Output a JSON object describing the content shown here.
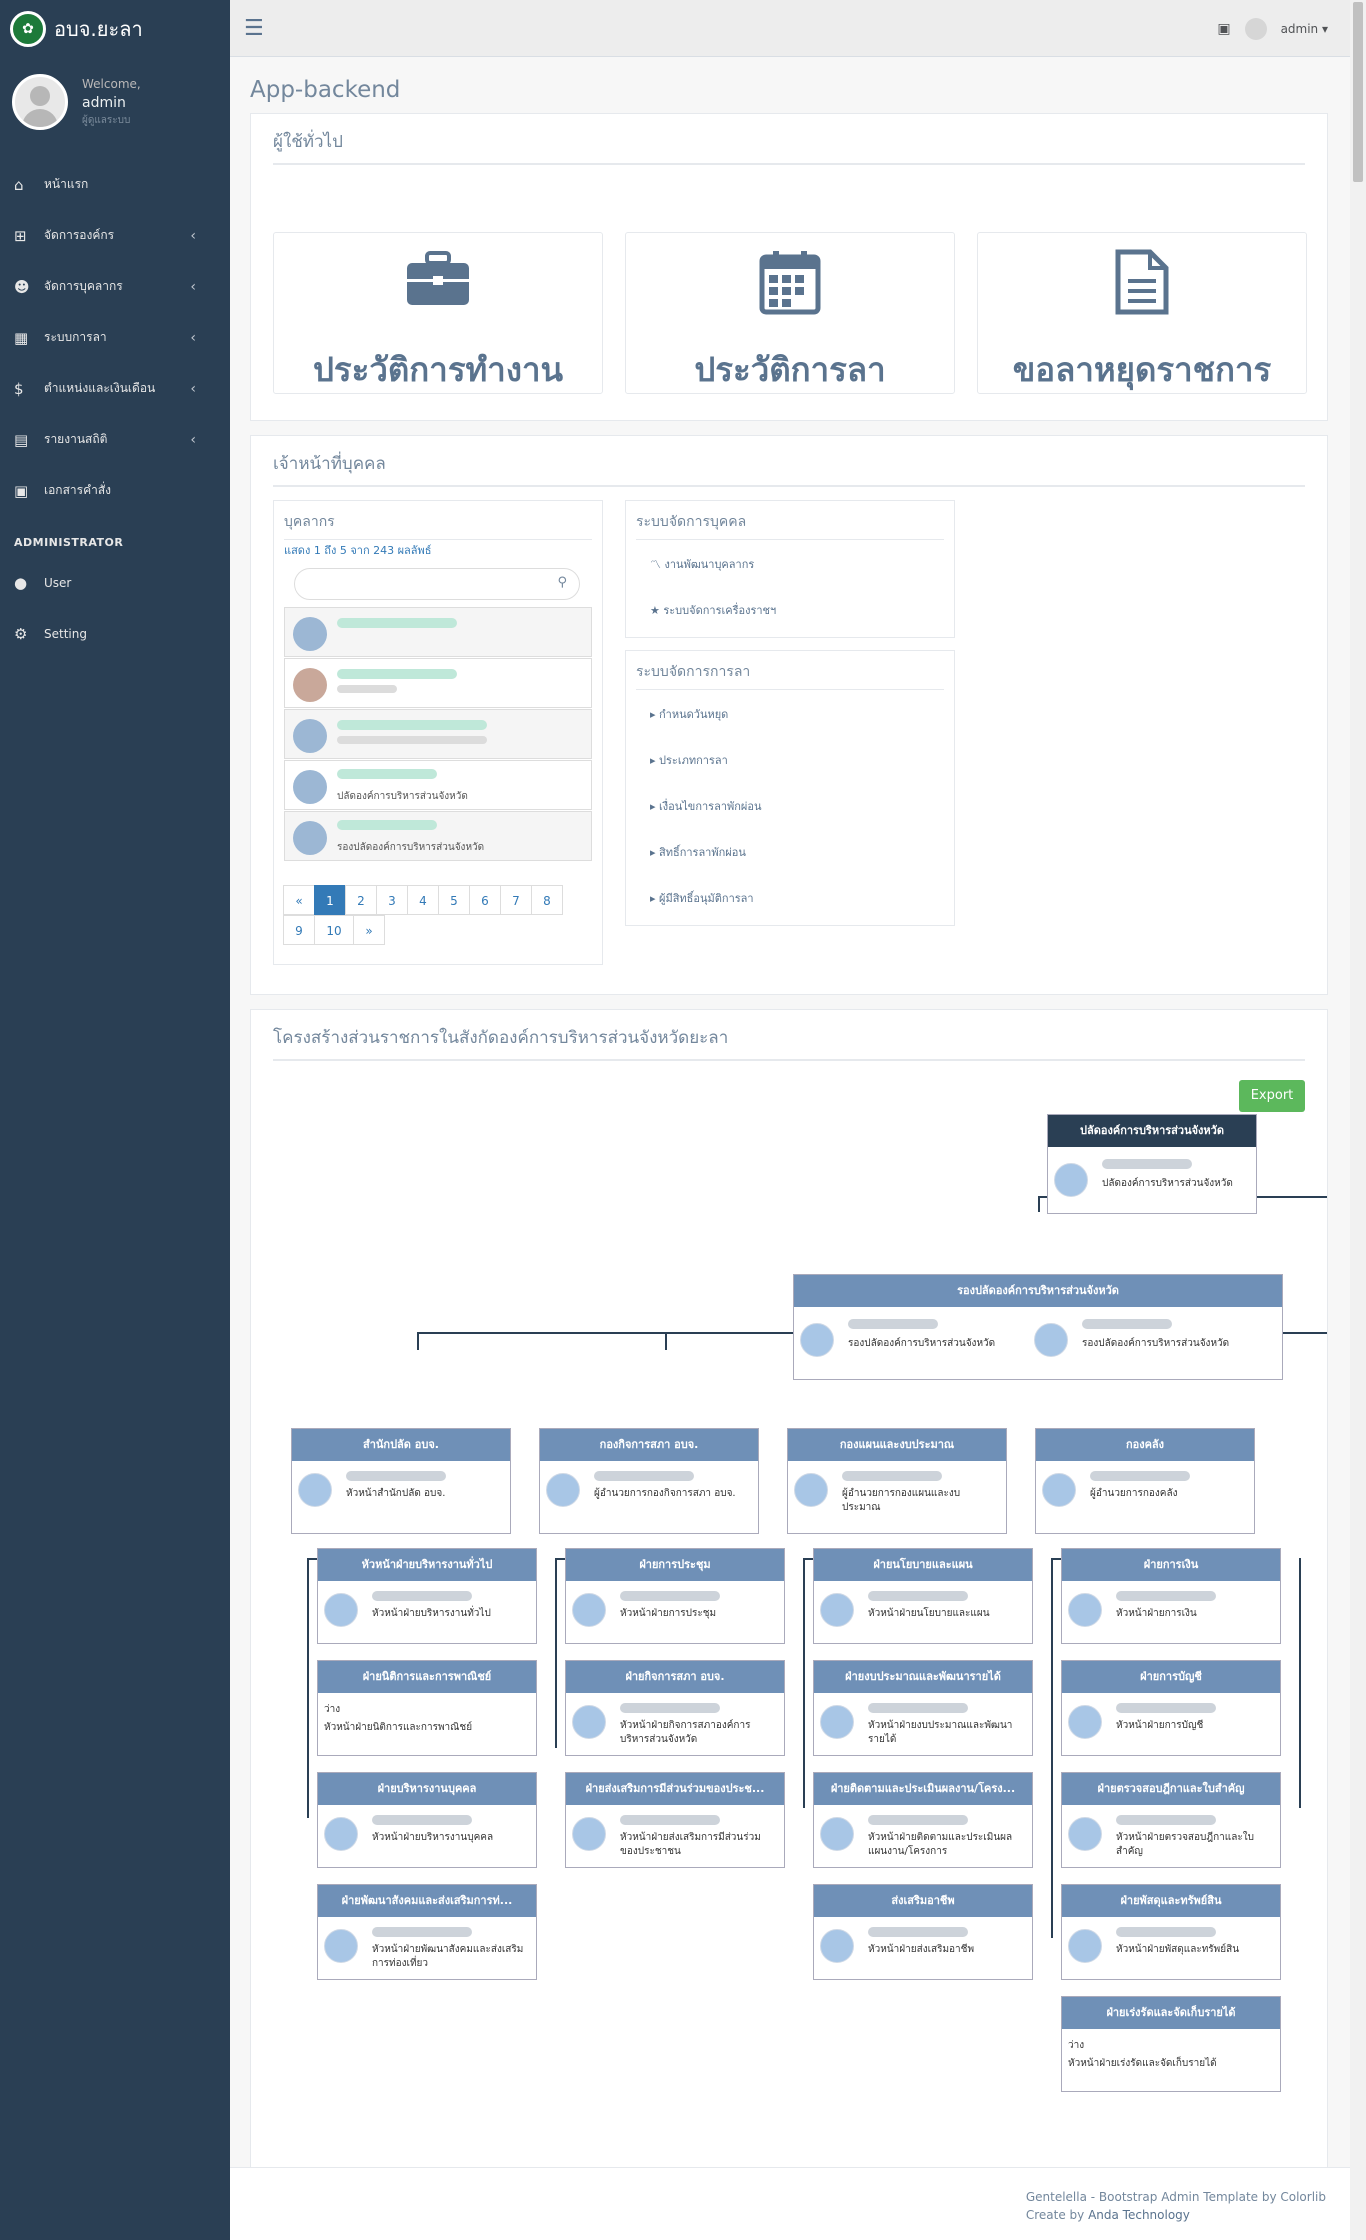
{
  "brand": {
    "title": "อบจ.ยะลา"
  },
  "profile": {
    "welcome": "Welcome,",
    "name": "admin",
    "role": "ผู้ดูแลระบบ"
  },
  "menu": [
    {
      "icon": "home-icon",
      "glyph": "⌂",
      "label": "หน้าแรก",
      "chevron": false
    },
    {
      "icon": "sitemap-icon",
      "glyph": "⊞",
      "label": "จัดการองค์กร",
      "chevron": true
    },
    {
      "icon": "users-icon",
      "glyph": "☻",
      "label": "จัดการบุคลากร",
      "chevron": true
    },
    {
      "icon": "calendar-icon",
      "glyph": "▦",
      "label": "ระบบการลา",
      "chevron": true
    },
    {
      "icon": "dollar-icon",
      "glyph": "$",
      "label": "ตำแหน่งและเงินเดือน",
      "chevron": true
    },
    {
      "icon": "book-icon",
      "glyph": "▤",
      "label": "รายงานสถิติ",
      "chevron": true
    },
    {
      "icon": "document-icon",
      "glyph": "▣",
      "label": "เอกสารคำสั่ง",
      "chevron": false
    }
  ],
  "admin_menu": {
    "title": "ADMINISTRATOR",
    "items": [
      {
        "icon": "user-icon",
        "glyph": "●",
        "label": "User"
      },
      {
        "icon": "gear-icon",
        "glyph": "⚙",
        "label": "Setting"
      }
    ]
  },
  "topbar": {
    "user": "admin ▾"
  },
  "page_title": "App-backend",
  "general": {
    "title": "ผู้ใช้ทั่วไป",
    "tiles": [
      {
        "label": "ประวัติการทำงาน",
        "icon": "briefcase-icon"
      },
      {
        "label": "ประวัติการลา",
        "icon": "calendar-icon"
      },
      {
        "label": "ขอลาหยุดราชการ",
        "icon": "file-icon"
      }
    ]
  },
  "hr": {
    "title": "เจ้าหน้าที่บุคคล",
    "personnel": {
      "title": "บุคลากร",
      "summary": "แสดง 1 ถึง 5 จาก 243 ผลลัพธ์",
      "items": [
        {
          "position": ""
        },
        {
          "position": ""
        },
        {
          "position": ""
        },
        {
          "position": "ปลัดองค์การบริหารส่วนจังหวัด"
        },
        {
          "position": "รองปลัดองค์การบริหารส่วนจังหวัด"
        }
      ],
      "pages_row1": [
        "«",
        "1",
        "2",
        "3",
        "4",
        "5",
        "6",
        "7",
        "8"
      ],
      "pages_row2": [
        "9",
        "10",
        "»"
      ]
    },
    "personnel_system": {
      "title": "ระบบจัดการบุคคล",
      "links": [
        "〽 งานพัฒนาบุคลากร",
        "★ ระบบจัดการเครื่องราชฯ"
      ]
    },
    "leave_system": {
      "title": "ระบบจัดการการลา",
      "links": [
        "▸ กำหนดวันหยุด",
        "▸ ประเภทการลา",
        "▸ เงื่อนไขการลาพักผ่อน",
        "▸ สิทธิ์การลาพักผ่อน",
        "▸ ผู้มีสิทธิ์อนุมัติการลา"
      ]
    }
  },
  "org": {
    "title": "โครงสร้างส่วนราชการในสังกัดองค์การบริหารส่วนจังหวัดยะลา",
    "export": "Export",
    "top": {
      "head": "ปลัดองค์การบริหารส่วนจังหวัด",
      "pos": "ปลัดองค์การบริหารส่วนจังหวัด"
    },
    "deputy": {
      "head": "รองปลัดองค์การบริหารส่วนจังหวัด",
      "pos1": "รองปลัดองค์การบริหารส่วนจังหวัด",
      "pos2": "รองปลัดองค์การบริหารส่วนจังหวัด"
    },
    "divisions": [
      {
        "head": "สำนักปลัด อบจ.",
        "pos": "หัวหน้าสำนักปลัด อบจ.",
        "subs": [
          {
            "head": "หัวหน้าฝ่ายบริหารงานทั่วไป",
            "pos": "หัวหน้าฝ่ายบริหารงานทั่วไป"
          },
          {
            "head": "ฝ่ายนิติการและการพาณิชย์",
            "pos": "หัวหน้าฝ่ายนิติการและการพาณิชย์",
            "vacant": "ว่าง"
          },
          {
            "head": "ฝ่ายบริหารงานบุคคล",
            "pos": "หัวหน้าฝ่ายบริหารงานบุคคล"
          },
          {
            "head": "ฝ่ายพัฒนาสังคมและส่งเสริมการท่...",
            "pos": "หัวหน้าฝ่ายพัฒนาสังคมและส่งเสริมการท่องเที่ยว"
          }
        ]
      },
      {
        "head": "กองกิจการสภา อบจ.",
        "pos": "ผู้อำนวยการกองกิจการสภา อบจ.",
        "subs": [
          {
            "head": "ฝ่ายการประชุม",
            "pos": "หัวหน้าฝ่ายการประชุม"
          },
          {
            "head": "ฝ่ายกิจการสภา อบจ.",
            "pos": "หัวหน้าฝ่ายกิจการสภาองค์การบริหารส่วนจังหวัด"
          },
          {
            "head": "ฝ่ายส่งเสริมการมีส่วนร่วมของประช...",
            "pos": "หัวหน้าฝ่ายส่งเสริมการมีส่วนร่วมของประชาชน"
          }
        ]
      },
      {
        "head": "กองแผนและงบประมาณ",
        "pos": "ผู้อำนวยการกองแผนและงบประมาณ",
        "subs": [
          {
            "head": "ฝ่ายนโยบายและแผน",
            "pos": "หัวหน้าฝ่ายนโยบายและแผน"
          },
          {
            "head": "ฝ่ายงบประมาณและพัฒนารายได้",
            "pos": "หัวหน้าฝ่ายงบประมาณและพัฒนารายได้"
          },
          {
            "head": "ฝ่ายติดตามและประเมินผลงาน/โครง...",
            "pos": "หัวหน้าฝ่ายติดตามและประเมินผลแผนงาน/โครงการ"
          },
          {
            "head": "ส่งเสริมอาชีพ",
            "pos": "หัวหน้าฝ่ายส่งเสริมอาชีพ"
          }
        ]
      },
      {
        "head": "กองคลัง",
        "pos": "ผู้อำนวยการกองคลัง",
        "subs": [
          {
            "head": "ฝ่ายการเงิน",
            "pos": "หัวหน้าฝ่ายการเงิน"
          },
          {
            "head": "ฝ่ายการบัญชี",
            "pos": "หัวหน้าฝ่ายการบัญชี"
          },
          {
            "head": "ฝ่ายตรวจสอบฎีกาและใบสำคัญ",
            "pos": "หัวหน้าฝ่ายตรวจสอบฎีกาและใบสำคัญ"
          },
          {
            "head": "ฝ่ายพัสดุและทรัพย์สิน",
            "pos": "หัวหน้าฝ่ายพัสดุและทรัพย์สิน"
          },
          {
            "head": "ฝ่ายเร่งรัดและจัดเก็บรายได้",
            "pos": "หัวหน้าฝ่ายเร่งรัดและจัดเก็บรายได้",
            "vacant": "ว่าง"
          }
        ]
      }
    ]
  },
  "footer": {
    "line1": "Gentelella - Bootstrap Admin Template by Colorlib",
    "line2_prefix": "Create by ",
    "line2_link": "Anda Technology"
  }
}
